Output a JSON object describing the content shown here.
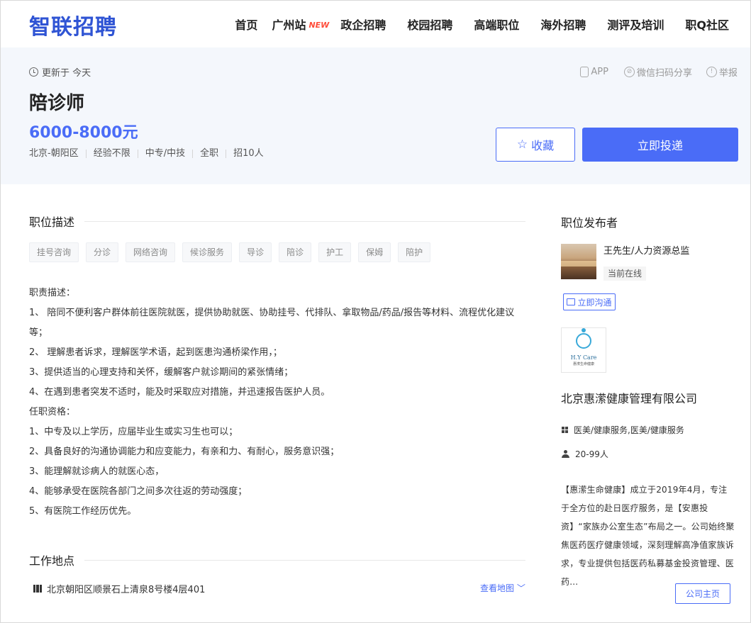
{
  "header": {
    "logo": "智联招聘",
    "nav": [
      {
        "label": "首页"
      },
      {
        "label": "广州站",
        "badge": "NEW"
      },
      {
        "label": "政企招聘"
      },
      {
        "label": "校园招聘"
      },
      {
        "label": "高端职位"
      },
      {
        "label": "海外招聘"
      },
      {
        "label": "测评及培训"
      },
      {
        "label": "职Q社区"
      }
    ]
  },
  "job": {
    "updated": "更新于 今天",
    "tools": {
      "app": "APP",
      "share": "微信扫码分享",
      "report": "举报"
    },
    "title": "陪诊师",
    "salary": "6000-8000元",
    "meta": [
      "北京-朝阳区",
      "经验不限",
      "中专/中技",
      "全职",
      "招10人"
    ],
    "favorite_label": "收藏",
    "apply_label": "立即投递"
  },
  "description": {
    "heading": "职位描述",
    "tags": [
      "挂号咨询",
      "分诊",
      "网络咨询",
      "候诊服务",
      "导诊",
      "陪诊",
      "护工",
      "保姆",
      "陪护"
    ],
    "lines": [
      "职责描述：",
      "1、 陪同不便利客户群体前往医院就医，提供协助就医、协助挂号、代排队、拿取物品/药品/报告等材料、流程优化建议等；",
      "2、 理解患者诉求，理解医学术语，起到医患沟通桥梁作用，；",
      "3、提供适当的心理支持和关怀，缓解客户就诊期间的紧张情绪；",
      "4、在遇到患者突发不适时，能及时采取应对措施，并迅速报告医护人员。",
      "任职资格：",
      "1、中专及以上学历，应届毕业生或实习生也可以；",
      "2、具备良好的沟通协调能力和应变能力，有亲和力、有耐心，服务意识强；",
      "3、能理解就诊病人的就医心态，",
      "4、能够承受在医院各部门之间多次往返的劳动强度；",
      "5、有医院工作经历优先。"
    ]
  },
  "location": {
    "heading": "工作地点",
    "address": "北京朝阳区顺景石上清泉8号楼4层401",
    "map_link": "查看地图 ﹀"
  },
  "publisher": {
    "heading": "职位发布者",
    "name": "王先生/人力资源总监",
    "status": "当前在线",
    "chat_label": "立即沟通"
  },
  "company": {
    "logo_text": "H.Y Care",
    "logo_sub": "惠潆生命健康",
    "name": "北京惠潆健康管理有限公司",
    "industry": "医美/健康服务,医美/健康服务",
    "size": "20-99人",
    "desc": "【惠潆生命健康】成立于2019年4月，专注于全方位的赴日医疗服务，是【安惠投资】“家族办公室生态”布局之一。公司始终聚焦医药医疗健康领域，深刻理解高净值家族诉求，专业提供包括医药私募基金投资管理、医药...",
    "home_label": "公司主页"
  },
  "colors": {
    "accent": "#4a6cf7",
    "brand": "#2f54d4",
    "new_badge": "#ff4d3a"
  }
}
